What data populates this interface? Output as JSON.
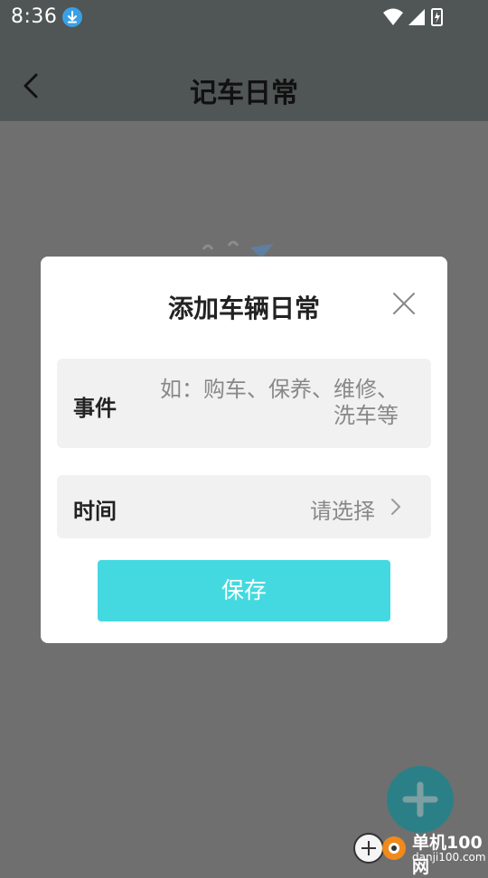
{
  "status_bar": {
    "time": "8:36"
  },
  "header": {
    "title": "记车日常"
  },
  "dialog": {
    "title": "添加车辆日常",
    "event": {
      "label": "事件",
      "placeholder_line1": "如：购车、保养、维修、",
      "placeholder_line2": "洗车等"
    },
    "time": {
      "label": "时间",
      "value": "请选择"
    },
    "save_label": "保存"
  },
  "watermark": {
    "name": "单机100网",
    "url": "danji100.com"
  },
  "colors": {
    "accent": "#44d9e0",
    "fab": "#2b8088",
    "overlay": "#6f6f6f"
  }
}
